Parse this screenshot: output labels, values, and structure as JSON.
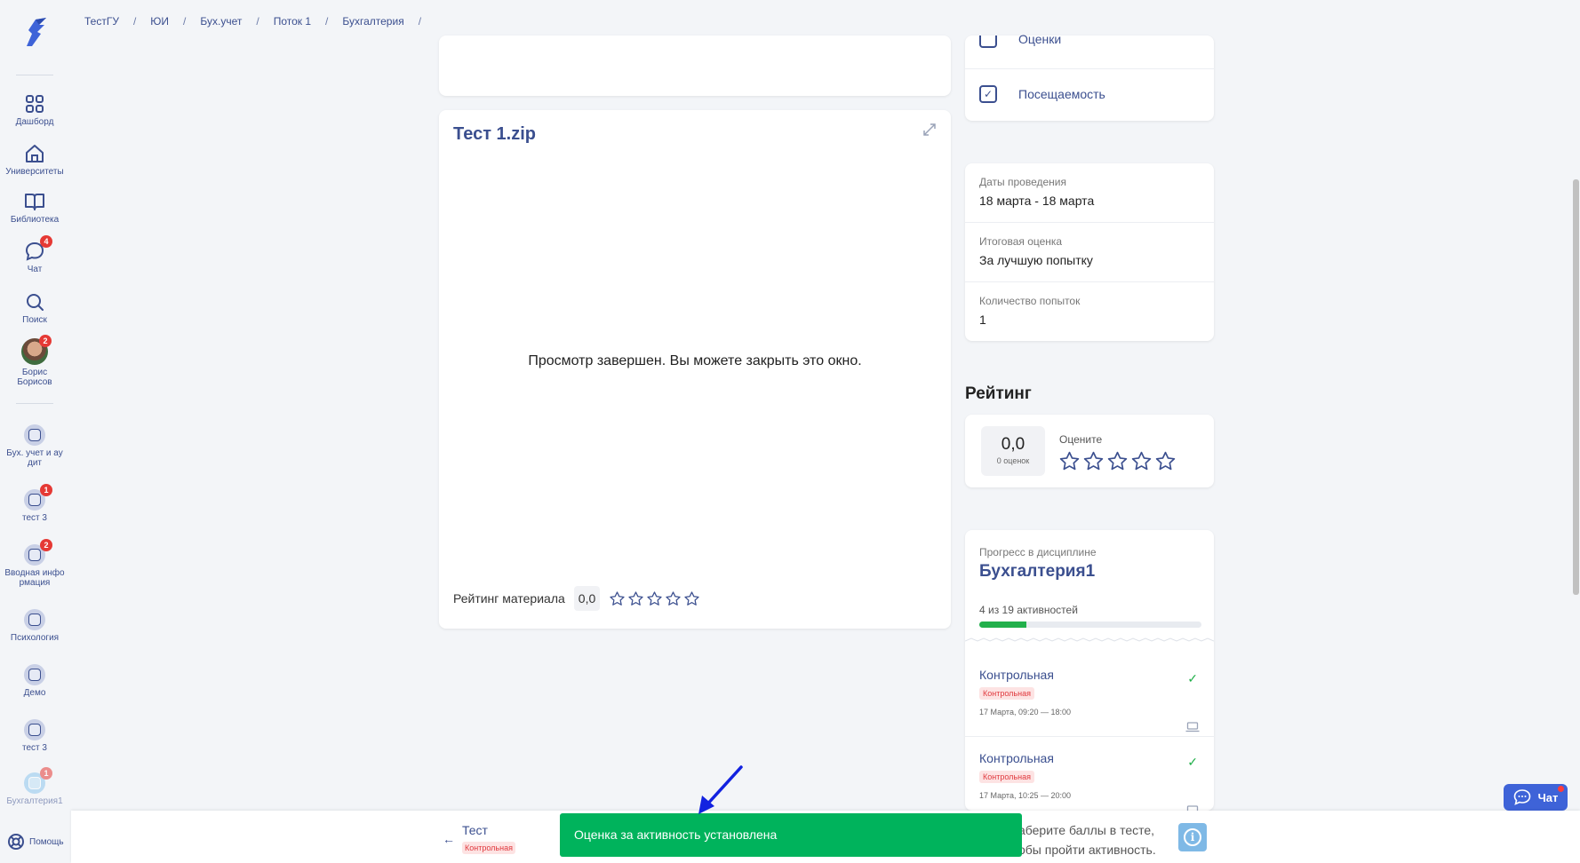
{
  "breadcrumbs": [
    "ТестГУ",
    "ЮИ",
    "Бух.учет",
    "Поток 1",
    "Бухгалтерия"
  ],
  "sidebar": {
    "nav": [
      {
        "label": "Дашборд",
        "icon": "dashboard-icon"
      },
      {
        "label": "Университеты",
        "icon": "university-icon"
      },
      {
        "label": "Библиотека",
        "icon": "library-icon"
      },
      {
        "label": "Чат",
        "icon": "chat-icon",
        "badge": "4"
      },
      {
        "label": "Поиск",
        "icon": "search-icon"
      },
      {
        "label": "Борис Борисов",
        "icon": "avatar",
        "badge": "2"
      }
    ],
    "courses": [
      {
        "label": "Бух. учет и ау дит"
      },
      {
        "label": "тест 3",
        "badge": "1"
      },
      {
        "label": "Вводная инфо рмация",
        "badge": "2"
      },
      {
        "label": "Психология"
      },
      {
        "label": "Демо"
      },
      {
        "label": "тест 3"
      },
      {
        "label": "Бухгалтерия1",
        "badge": "1"
      }
    ],
    "help_label": "Помощь"
  },
  "viewer": {
    "title": "Тест 1.zip",
    "message": "Просмотр завершен. Вы можете закрыть это окно.",
    "rating_label": "Рейтинг материала",
    "rating_value": "0,0",
    "stars_filled": 0,
    "stars_total": 5
  },
  "side_menu": {
    "grades_label": "Оценки",
    "attendance_label": "Посещаемость"
  },
  "details": {
    "dates_label": "Даты проведения",
    "dates_value": "18 марта - 18 марта",
    "final_grade_label": "Итоговая оценка",
    "final_grade_value": "За лучшую попытку",
    "attempts_label": "Количество попыток",
    "attempts_value": "1"
  },
  "rating": {
    "heading": "Рейтинг",
    "score": "0,0",
    "count": "0 оценок",
    "rate_label": "Оцените"
  },
  "progress": {
    "label": "Прогресс в дисциплине",
    "title": "Бухгалтерия1",
    "count": "4 из 19 активностей",
    "fraction": 0.21,
    "activities": [
      {
        "title": "Контрольная",
        "tag": "Контрольная",
        "time": "17 Марта, 09:20 — 18:00"
      },
      {
        "title": "Контрольная",
        "tag": "Контрольная",
        "time": "17 Марта, 10:25 — 20:00"
      }
    ]
  },
  "bottom": {
    "back_title": "Тест",
    "back_tag": "Контрольная",
    "hint_line1": "аберите баллы в тесте,",
    "hint_line2": "обы пройти активность."
  },
  "toast": "Оценка за активность установлена",
  "chat_button": "Чат",
  "colors": {
    "accent": "#3b4f8f",
    "success": "#00b35c",
    "danger": "#e53935",
    "chat": "#3e63d8"
  }
}
